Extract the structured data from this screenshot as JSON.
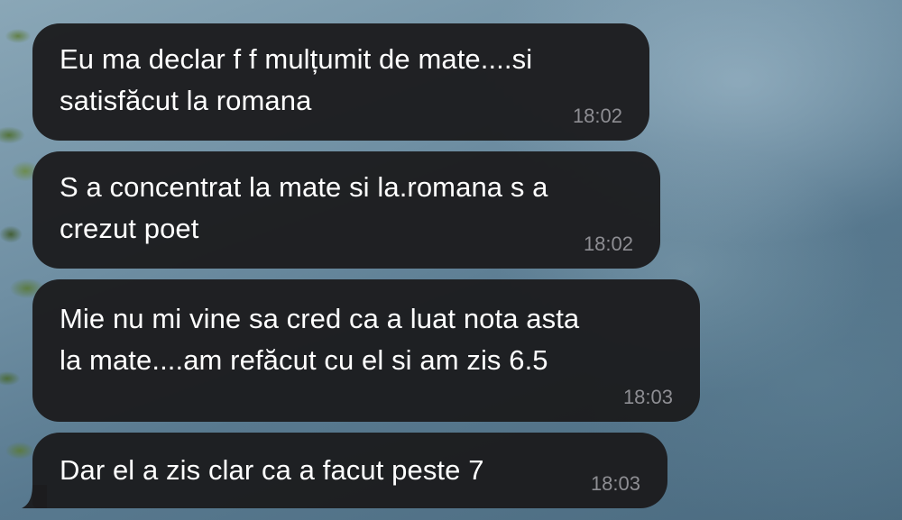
{
  "conversation": {
    "messages": [
      {
        "text": "Eu ma declar f f mulțumit de mate....si\nsatisfăcut la romana",
        "time": "18:02"
      },
      {
        "text": "S a concentrat la mate si la.romana s a\ncrezut poet",
        "time": "18:02"
      },
      {
        "text": "Mie nu mi vine sa cred ca a luat nota asta\nla mate....am refăcut cu el si am zis 6.5",
        "time": "18:03"
      },
      {
        "text": "Dar el a zis clar ca a facut peste 7",
        "time": "18:03"
      }
    ]
  },
  "colors": {
    "bubble": "#1c1c1e",
    "text": "#ffffff",
    "timestamp": "#8e8e93"
  }
}
